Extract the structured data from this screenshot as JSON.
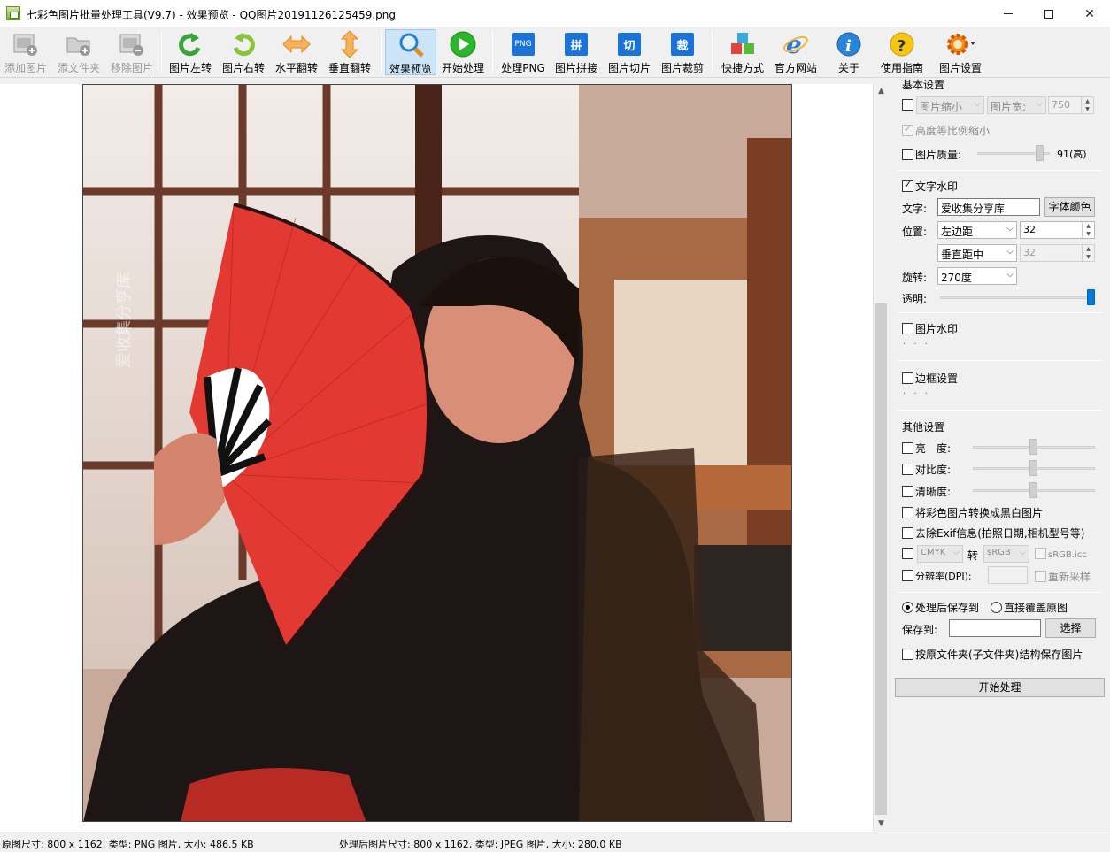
{
  "window": {
    "title": "七彩色图片批量处理工具(V9.7) - 效果预览 - QQ图片20191126125459.png"
  },
  "toolbar": {
    "add_image": "添加图片",
    "add_folder": "添文件夹",
    "remove_image": "移除图片",
    "rotate_left": "图片左转",
    "rotate_right": "图片右转",
    "flip_h": "水平翻转",
    "flip_v": "垂直翻转",
    "preview": "效果预览",
    "start": "开始处理",
    "png": "处理PNG",
    "png_icon_text": "PNG",
    "stitch": "图片拼接",
    "stitch_icon_text": "拼",
    "slice": "图片切片",
    "slice_icon_text": "切",
    "crop": "图片裁剪",
    "crop_icon_text": "裁",
    "shortcut": "快捷方式",
    "website": "官方网站",
    "about": "关于",
    "help": "使用指南",
    "settings": "图片设置"
  },
  "preview": {
    "watermark_text": "爱收集分享库"
  },
  "settings": {
    "basic": {
      "header": "基本设置",
      "resize_label": "图片缩小",
      "width_label": "图片宽:",
      "width_value": "750",
      "keep_ratio": "高度等比例缩小",
      "quality_label": "图片质量:",
      "quality_value": "91(高)",
      "quality_level": 0.91
    },
    "text_watermark": {
      "label": "文字水印",
      "text_label": "文字:",
      "text_value": "爱收集分享库",
      "font_color_button": "字体颜色",
      "position_label": "位置:",
      "h_position": "左边距",
      "h_value": "32",
      "v_position": "垂直距中",
      "v_value": "32",
      "rotate_label": "旋转:",
      "rotate_value": "270度",
      "opacity_label": "透明:",
      "opacity_level": 1.0
    },
    "image_watermark": {
      "label": "图片水印",
      "dots": "· · ·"
    },
    "border": {
      "label": "边框设置",
      "dots": "· · ·"
    },
    "other": {
      "header": "其他设置",
      "brightness": "亮　度:",
      "contrast": "对比度:",
      "sharpness": "清晰度:",
      "grayscale": "将彩色图片转换成黑白图片",
      "remove_exif": "去除Exif信息(拍照日期,相机型号等)",
      "cmyk": "CMYK",
      "to_label": "转",
      "srgb": "sRGB",
      "srgb_icc": "sRGB.icc",
      "dpi_label": "分辨率(DPI):",
      "resample": "重新采样"
    },
    "output": {
      "save_to_option": "处理后保存到",
      "overwrite_option": "直接覆盖原图",
      "save_to_label": "保存到:",
      "save_to_value": "",
      "choose_button": "选择",
      "keep_structure": "按原文件夹(子文件夹)结构保存图片"
    },
    "start_button": "开始处理"
  },
  "status": {
    "original": "原图尺寸: 800 x 1162, 类型: PNG 图片, 大小: 486.5 KB",
    "processed": "处理后图片尺寸: 800 x 1162, 类型: JPEG 图片, 大小: 280.0 KB"
  }
}
